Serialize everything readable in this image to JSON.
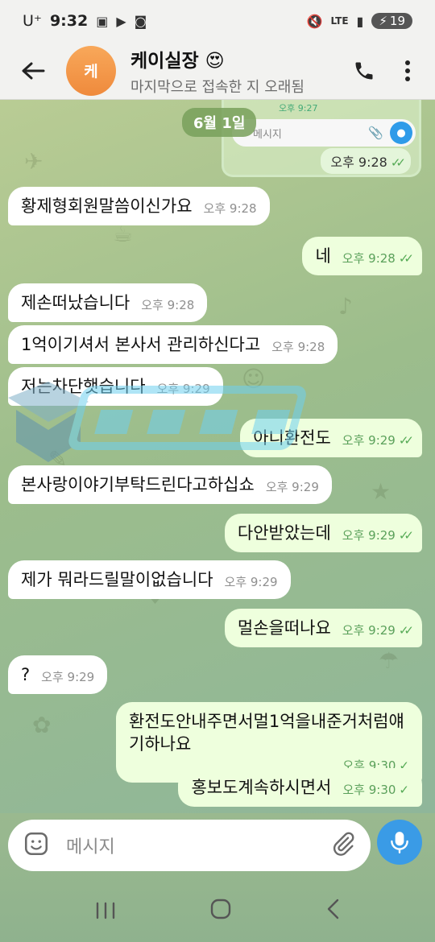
{
  "status_bar": {
    "carrier": "U⁺",
    "time": "9:32",
    "network": "LTE",
    "battery": "19"
  },
  "header": {
    "avatar_letter": "케",
    "title": "케이실장 😍",
    "subtitle": "마지막으로 접속한 지 오래됨"
  },
  "forwarded_preview": {
    "mini_time": "오후 9:27",
    "input_placeholder": "메시지",
    "time": "오후 9:28"
  },
  "date_chip": "6월 1일",
  "messages": [
    {
      "dir": "in",
      "text": "황제형회원말씀이신가요",
      "time": "오후 9:28"
    },
    {
      "dir": "out",
      "text": "네",
      "time": "오후 9:28",
      "status": "read"
    },
    {
      "dir": "in",
      "text": "제손떠났습니다",
      "time": "오후 9:28"
    },
    {
      "dir": "in",
      "text": "1억이기셔서 본사서 관리하신다고",
      "time": "오후 9:28"
    },
    {
      "dir": "in",
      "text": "저는차단햇습니다",
      "time": "오후 9:29"
    },
    {
      "dir": "out",
      "text": "아니환전도",
      "time": "오후 9:29",
      "status": "read"
    },
    {
      "dir": "in",
      "text": "본사랑이야기부탁드린다고하십쇼",
      "time": "오후 9:29"
    },
    {
      "dir": "out",
      "text": "다안받았는데",
      "time": "오후 9:29",
      "status": "read"
    },
    {
      "dir": "in",
      "text": "제가 뭐라드릴말이없습니다",
      "time": "오후 9:29"
    },
    {
      "dir": "out",
      "text": "멀손을떠나요",
      "time": "오후 9:29",
      "status": "read"
    },
    {
      "dir": "in",
      "text": "?",
      "time": "오후 9:29"
    },
    {
      "dir": "out",
      "text": "환전도안내주면서멀1억을내준거처럼얘기하나요",
      "time": "오후 9:30",
      "status": "sent"
    },
    {
      "dir": "out",
      "text": "홍보도계속하시면서",
      "time": "오후 9:30",
      "status": "sent"
    }
  ],
  "input": {
    "placeholder": "메시지"
  },
  "colors": {
    "incoming_bubble": "#ffffff",
    "outgoing_bubble": "#eeffdd",
    "accent": "#3a9be6",
    "avatar": "#f39a4a"
  }
}
